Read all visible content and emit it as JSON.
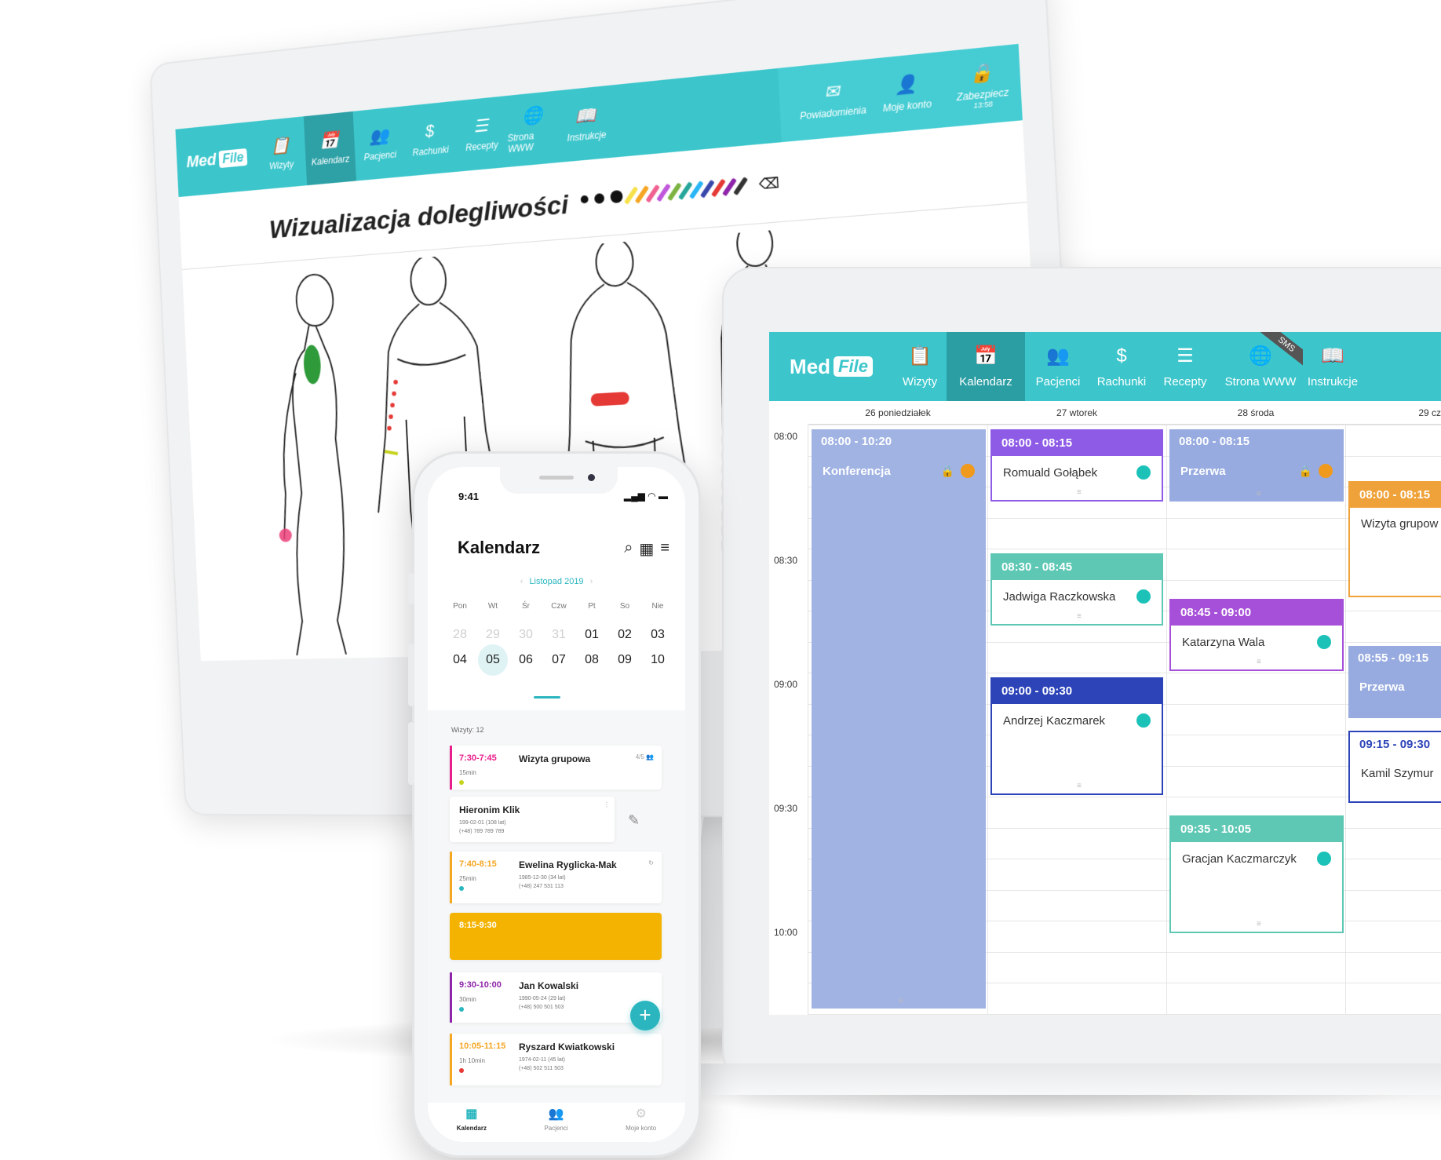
{
  "desktop": {
    "logo": {
      "left": "Med",
      "box": "File"
    },
    "nav": [
      {
        "label": "Wizyty",
        "icon": "clipboard-icon"
      },
      {
        "label": "Kalendarz",
        "icon": "calendar-icon",
        "active": true
      },
      {
        "label": "Pacjenci",
        "icon": "users-icon"
      },
      {
        "label": "Rachunki",
        "icon": "dollar-icon"
      },
      {
        "label": "Recepty",
        "icon": "list-icon"
      },
      {
        "label": "Strona WWW",
        "icon": "globe-icon",
        "badge": "SMS"
      },
      {
        "label": "Instrukcje",
        "icon": "book-icon"
      }
    ],
    "nav_right": [
      {
        "label": "Powiadomienia",
        "icon": "envelope-icon"
      },
      {
        "label": "Moje konto",
        "icon": "user-icon"
      },
      {
        "label": "Zabezpiecz",
        "sublabel": "13:58",
        "icon": "lock-icon"
      }
    ],
    "title": "Wizualizacja dolegliwości",
    "palette": [
      "#111111",
      "#111111",
      "#111111",
      "#f7e14b",
      "#f5a623",
      "#f06292",
      "#c158dc",
      "#7cb342",
      "#26a69a",
      "#29b6f6",
      "#3949ab",
      "#e53935",
      "#333333"
    ]
  },
  "laptop": {
    "logo": {
      "left": "Med",
      "box": "File"
    },
    "nav": [
      {
        "label": "Wizyty",
        "icon": "clipboard-icon"
      },
      {
        "label": "Kalendarz",
        "icon": "calendar-icon",
        "active": true
      },
      {
        "label": "Pacjenci",
        "icon": "users-icon"
      },
      {
        "label": "Rachunki",
        "icon": "dollar-icon"
      },
      {
        "label": "Recepty",
        "icon": "list-icon"
      },
      {
        "label": "Strona WWW",
        "icon": "globe-icon",
        "badge": "SMS"
      },
      {
        "label": "Instrukcje",
        "icon": "book-icon"
      }
    ],
    "days": [
      "26 poniedziałek",
      "27 wtorek",
      "28 środa",
      "29 cz"
    ],
    "times": [
      "08:00",
      "08:30",
      "09:00",
      "09:30",
      "10:00"
    ],
    "events": [
      {
        "time": "08:00 - 10:20",
        "name": "Konferencja",
        "kind": "block"
      },
      {
        "time": "08:00 - 08:15",
        "name": "Romuald Gołąbek",
        "kind": "visit"
      },
      {
        "time": "08:00 - 08:15",
        "name": "Przerwa",
        "kind": "block"
      },
      {
        "time": "08:00 - 08:15",
        "name": "Wizyta grupow",
        "kind": "visit"
      },
      {
        "time": "08:30 - 08:45",
        "name": "Jadwiga Raczkowska",
        "kind": "visit"
      },
      {
        "time": "08:45 - 09:00",
        "name": "Katarzyna Wala",
        "kind": "visit"
      },
      {
        "time": "08:55 - 09:15",
        "name": "Przerwa",
        "kind": "block"
      },
      {
        "time": "09:00 - 09:30",
        "name": "Andrzej Kaczmarek",
        "kind": "visit"
      },
      {
        "time": "09:15 - 09:30",
        "name": "Kamil Szymur",
        "kind": "visit"
      },
      {
        "time": "09:35 - 10:05",
        "name": "Gracjan Kaczmarczyk",
        "kind": "visit"
      }
    ]
  },
  "phone": {
    "time": "9:41",
    "title": "Kalendarz",
    "month": "Listopad 2019",
    "weekdays": [
      "Pon",
      "Wt",
      "Śr",
      "Czw",
      "Pt",
      "So",
      "Nie"
    ],
    "week1": [
      "28",
      "29",
      "30",
      "31",
      "01",
      "02",
      "03"
    ],
    "week2": [
      "04",
      "05",
      "06",
      "07",
      "08",
      "09",
      "10"
    ],
    "count": "Wizyty: 12",
    "cards": [
      {
        "time": "7:30-7:45",
        "dur": "15min",
        "name": "Wizyta grupowa",
        "side": "4/5 👥",
        "color": "#e91e8c",
        "dot": "#c6d21e"
      },
      {
        "time": "",
        "dur": "",
        "name": "Hieronim Klik",
        "l1": "199-02-01 (108 lat)",
        "l2": "(+48) 789 789 789",
        "color": "",
        "dot": ""
      },
      {
        "time": "7:40-8:15",
        "dur": "25min",
        "name": "Ewelina Ryglicka-Mak",
        "l1": "1985-12-30 (34 lat)",
        "l2": "(+48) 247 531 113",
        "color": "#f5a623",
        "dot": "#2bb6bf"
      },
      {
        "time": "8:15-9:30",
        "color": "#f5b301"
      },
      {
        "time": "9:30-10:00",
        "dur": "30min",
        "name": "Jan Kowalski",
        "l1": "1990-05-24 (29 lat)",
        "l2": "(+48) 500 501 503",
        "color": "#8e24aa",
        "dot": "#2bb6bf"
      },
      {
        "time": "10:05-11:15",
        "dur": "1h 10min",
        "name": "Ryszard Kwiatkowski",
        "l1": "1974-02-11 (45 lat)",
        "l2": "(+48) 502 511 503",
        "color": "#f5a623",
        "dot": "#e53935"
      }
    ],
    "tabs": [
      {
        "label": "Kalendarz",
        "icon": "calendar-icon",
        "active": true
      },
      {
        "label": "Pacjenci",
        "icon": "users-icon"
      },
      {
        "label": "Moje konto",
        "icon": "gear-icon"
      }
    ]
  }
}
